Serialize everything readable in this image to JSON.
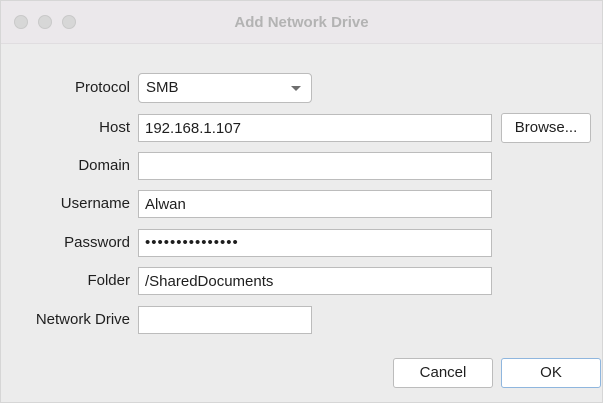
{
  "window": {
    "title": "Add Network Drive"
  },
  "form": {
    "protocol": {
      "label": "Protocol",
      "value": "SMB"
    },
    "host": {
      "label": "Host",
      "value": "192.168.1.107",
      "browse_label": "Browse..."
    },
    "domain": {
      "label": "Domain",
      "value": ""
    },
    "username": {
      "label": "Username",
      "value": "Alwan"
    },
    "password": {
      "label": "Password",
      "masked_value": "•••••••••••••••"
    },
    "folder": {
      "label": "Folder",
      "value": "/SharedDocuments"
    },
    "network_drive": {
      "label": "Network Drive",
      "value": ""
    }
  },
  "buttons": {
    "cancel_label": "Cancel",
    "ok_label": "OK"
  },
  "icons": {
    "dropdown": "chevron-down-icon"
  },
  "colors": {
    "window_bg": "#ececec",
    "titlebar_bg": "#ebe8eb",
    "title_text": "#b3b3b3",
    "ok_border": "#8fb6de"
  }
}
